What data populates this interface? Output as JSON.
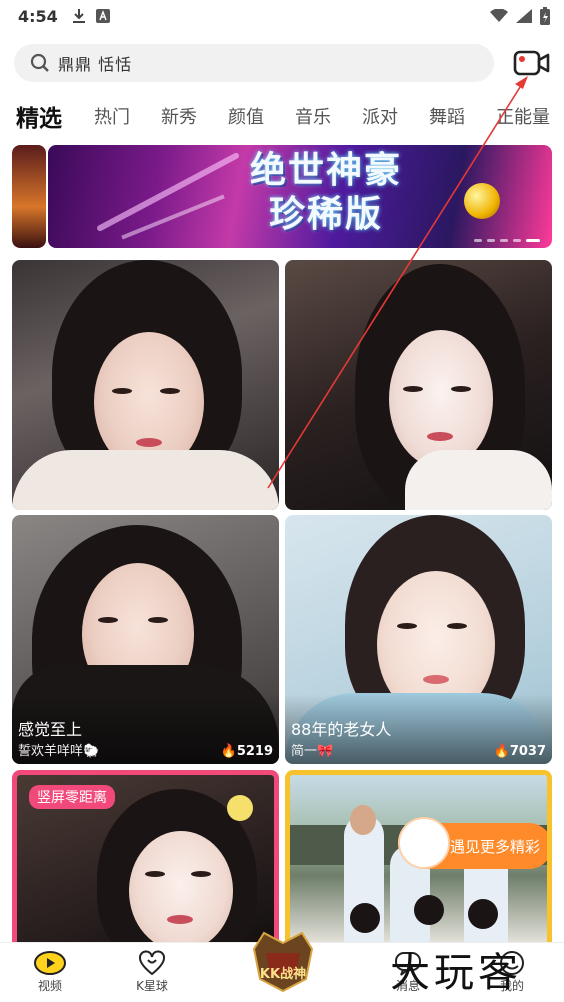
{
  "status": {
    "time": "4:54"
  },
  "search": {
    "text": "鼎鼎 恬恬"
  },
  "tabs": [
    "精选",
    "热门",
    "新秀",
    "颜值",
    "音乐",
    "派对",
    "舞蹈",
    "正能量"
  ],
  "banner": {
    "title_line1": "绝世神豪",
    "title_line2": "珍稀版"
  },
  "cards": [
    {
      "title": "",
      "sub": "",
      "heat": ""
    },
    {
      "title": "",
      "sub": "",
      "heat": ""
    },
    {
      "title": "感觉至上",
      "sub": "誓欢羊咩咩🐑",
      "heat": "5219"
    },
    {
      "title": "88年的老女人",
      "sub": "简一🎀",
      "heat": "7037"
    },
    {
      "tag": "竖屏零距离"
    },
    {
      "promo": "遇见更多精彩"
    }
  ],
  "nav": {
    "video": "视频",
    "kplanet": "K星球",
    "center": "KK战神",
    "message": "消息",
    "me": "我的"
  },
  "watermark": "大玩客",
  "colors": {
    "accent": "#ffc400",
    "pink": "#f14a7a",
    "gold": "#f7c22b",
    "live_red": "#e53935"
  }
}
